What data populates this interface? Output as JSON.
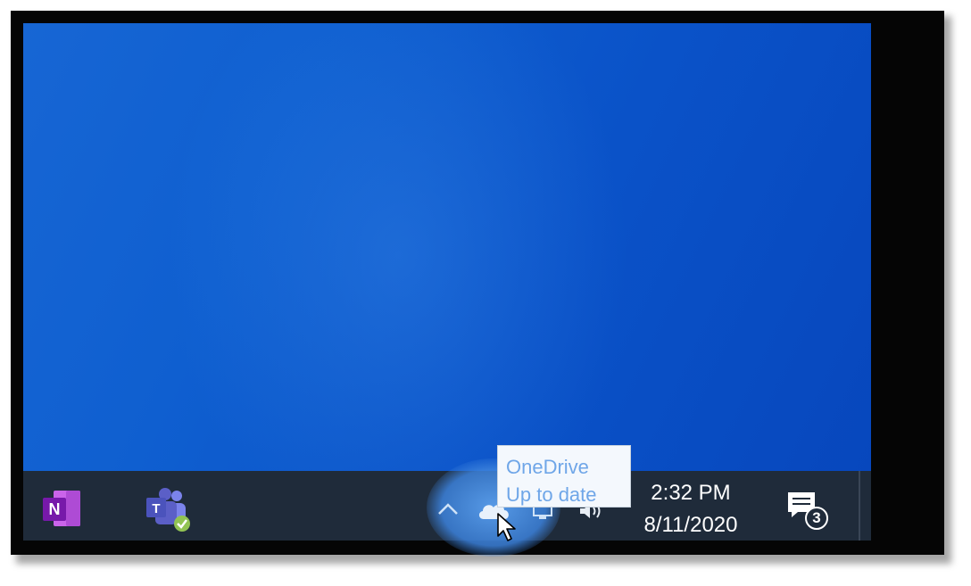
{
  "taskbar": {
    "pinned_apps": [
      {
        "name": "OneNote",
        "icon": "onenote-icon",
        "glyph": "N",
        "color": "#7719aa"
      },
      {
        "name": "Microsoft Teams",
        "icon": "teams-icon",
        "glyph": "T",
        "color": "#5b5fc7"
      }
    ],
    "tray": {
      "show_hidden_icon": "chevron-up-icon",
      "onedrive_icon": "cloud-icon",
      "network_icon": "network-icon",
      "volume_icon": "speaker-icon"
    },
    "clock": {
      "time": "2:32 PM",
      "date": "8/11/2020"
    },
    "notifications": {
      "icon": "action-center-icon",
      "count": "3"
    }
  },
  "tooltip": {
    "title": "OneDrive",
    "status": "Up to date"
  },
  "colors": {
    "desktop": "#0a52c8",
    "taskbar": "#1f2b3a",
    "tooltip_text": "#6fa6e8"
  }
}
